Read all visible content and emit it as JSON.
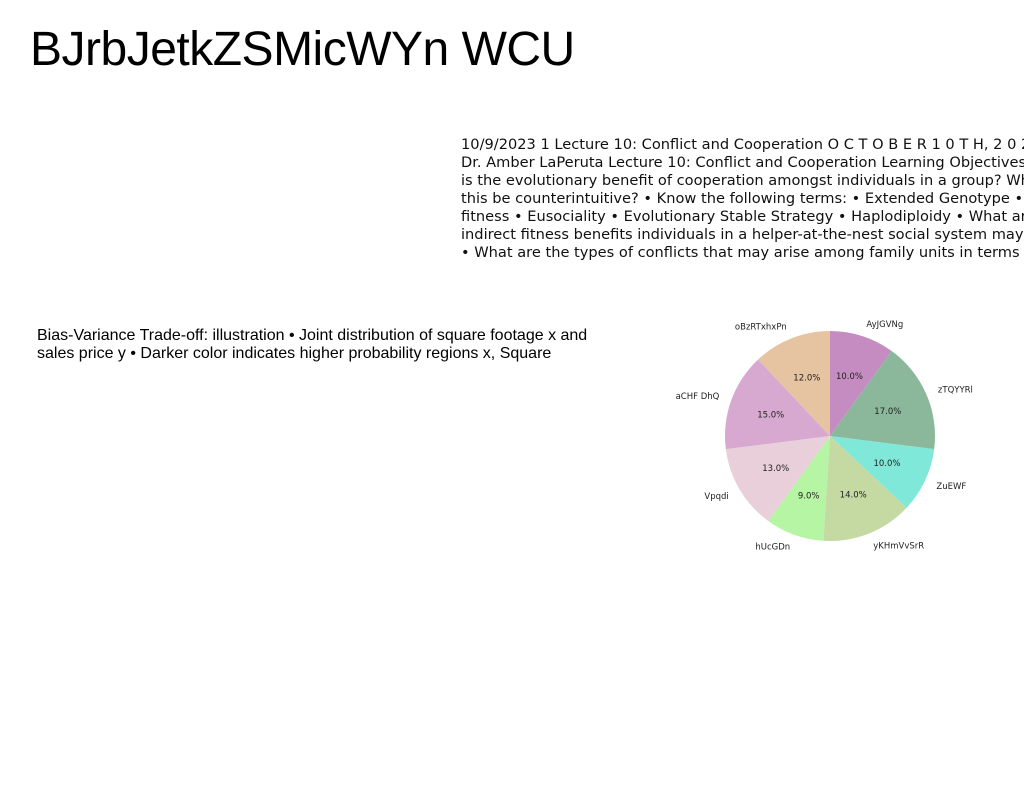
{
  "title": "BJrbJetkZSMicWYn WCU",
  "text_block": {
    "lines": [
      "10/9/2023 1 Lecture 10: Conflict and Cooperation O C T O B E R 1 0 T H, 2 0 2",
      "Dr. Amber LaPeruta Lecture 10: Conflict and Cooperation Learning Objectives •",
      "is the evolutionary benefit of cooperation amongst individuals in a group? Why",
      "this be counterintuitive? • Know the following terms: • Extended Genotype •",
      "fitness • Eusociality • Evolutionary Stable Strategy • Haplodiploidy • What are",
      "indirect fitness benefits individuals in a helper-at-the-nest social system may",
      "• What are the types of conflicts that may arise among family units in terms of"
    ]
  },
  "caption": "Bias-Variance Trade-off: illustration • Joint distribution of square footage x and sales price y • Darker color indicates higher probability regions x, Square",
  "chart_data": {
    "type": "pie",
    "start_angle_deg": 90,
    "direction": "clockwise",
    "slices": [
      {
        "label": "AyJGVNg",
        "value": 10.0,
        "pct_label": "10.0%",
        "color": "#c58cc1"
      },
      {
        "label": "zTQYYRl",
        "value": 17.0,
        "pct_label": "17.0%",
        "color": "#8bb89a"
      },
      {
        "label": "ZuEWF",
        "value": 10.0,
        "pct_label": "10.0%",
        "color": "#7fe8d9"
      },
      {
        "label": "yKHmVvSrR",
        "value": 14.0,
        "pct_label": "14.0%",
        "color": "#c5d9a3"
      },
      {
        "label": "hUcGDn",
        "value": 9.0,
        "pct_label": "9.0%",
        "color": "#b6f5a3"
      },
      {
        "label": "Vpqdi",
        "value": 13.0,
        "pct_label": "13.0%",
        "color": "#e8cfd9"
      },
      {
        "label": "aCHF DhQ",
        "value": 15.0,
        "pct_label": "15.0%",
        "color": "#d8a9d0"
      },
      {
        "label": "oBzRTxhxPn",
        "value": 12.0,
        "pct_label": "12.0%",
        "color": "#e6c4a1"
      }
    ]
  }
}
